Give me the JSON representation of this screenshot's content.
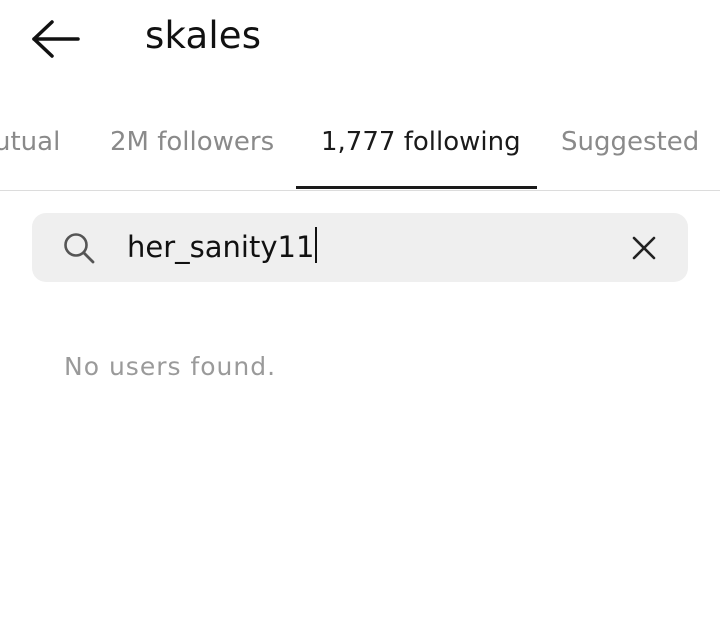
{
  "header": {
    "back_icon": "arrow-left-icon",
    "title": "skales"
  },
  "tabs": [
    {
      "label": "Mutual",
      "visible_label": "utual",
      "active": false
    },
    {
      "label": "2M followers",
      "active": false
    },
    {
      "label": "1,777 following",
      "active": true
    },
    {
      "label": "Suggested",
      "active": false
    }
  ],
  "search": {
    "icon": "search-icon",
    "value": "her_sanity11",
    "clear_icon": "close-icon"
  },
  "results": {
    "empty_message": "No users found."
  },
  "colors": {
    "background": "#ffffff",
    "text_primary": "#1a1a1a",
    "text_secondary": "#8a8a8a",
    "search_background": "#efefef",
    "divider": "#dcdcdc"
  }
}
